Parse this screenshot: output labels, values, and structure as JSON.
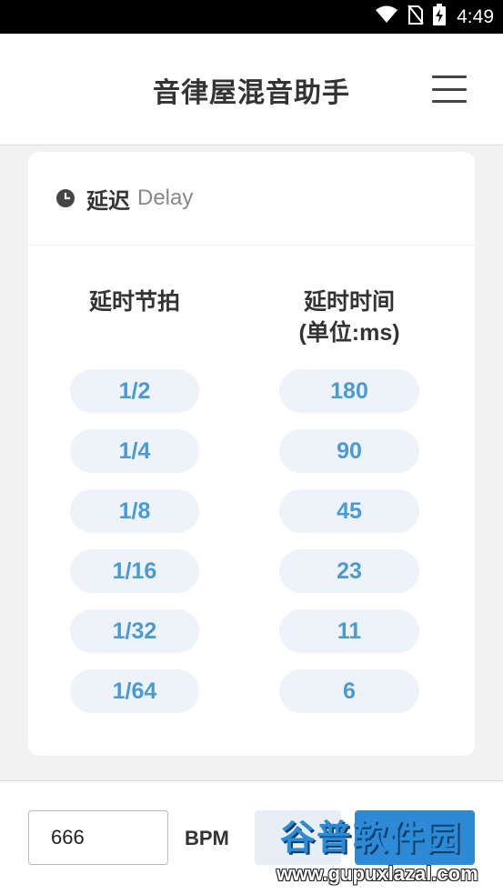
{
  "status_bar": {
    "time": "4:49",
    "icons": [
      "wifi-icon",
      "no-sim-icon",
      "battery-charging-icon"
    ]
  },
  "app_bar": {
    "title": "音律屋混音助手",
    "menu_icon": "hamburger-menu-icon"
  },
  "card": {
    "icon": "clock-icon",
    "title": "延迟",
    "subtitle": "Delay",
    "col_beat_header": "延时节拍",
    "col_time_header_line1": "延时时间",
    "col_time_header_line2": "(单位:ms)",
    "rows": [
      {
        "beat": "1/2",
        "time": "180"
      },
      {
        "beat": "1/4",
        "time": "90"
      },
      {
        "beat": "1/8",
        "time": "45"
      },
      {
        "beat": "1/16",
        "time": "23"
      },
      {
        "beat": "1/32",
        "time": "11"
      },
      {
        "beat": "1/64",
        "time": "6"
      }
    ]
  },
  "bottom_bar": {
    "bpm_value": "666",
    "bpm_label": "BPM"
  },
  "watermark": {
    "main": "谷普软件园",
    "url": "www.gupuxlazal.com"
  },
  "colors": {
    "accent": "#2f8ad6",
    "pill_text": "#4a9ad6",
    "pill_bg": "#eef3f9"
  }
}
